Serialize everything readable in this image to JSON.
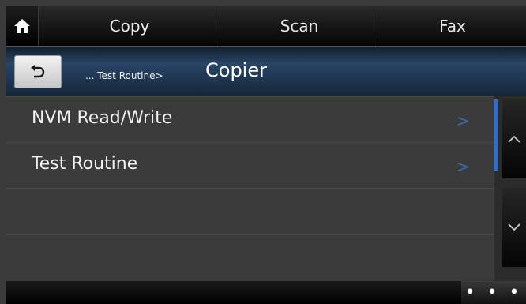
{
  "tabs": {
    "home_icon": "home-icon",
    "items": [
      {
        "label": "Copy"
      },
      {
        "label": "Scan"
      },
      {
        "label": "Fax"
      }
    ]
  },
  "header": {
    "back_icon": "back-arrow-icon",
    "crumb_prefix": "... Test Routine>",
    "current": "Copier"
  },
  "list": {
    "items": [
      {
        "label": "NVM Read/Write",
        "chevron": ">"
      },
      {
        "label": "Test Routine",
        "chevron": ">"
      },
      {
        "label": ""
      },
      {
        "label": ""
      }
    ]
  },
  "scroll": {
    "up_icon": "chevron-up-icon",
    "down_icon": "chevron-down-icon",
    "up_glyph": "^",
    "down_glyph": "v"
  },
  "footer": {
    "more_label": "• • •"
  },
  "colors": {
    "accent": "#2f6bd0",
    "chevron": "#3f6aa8"
  }
}
